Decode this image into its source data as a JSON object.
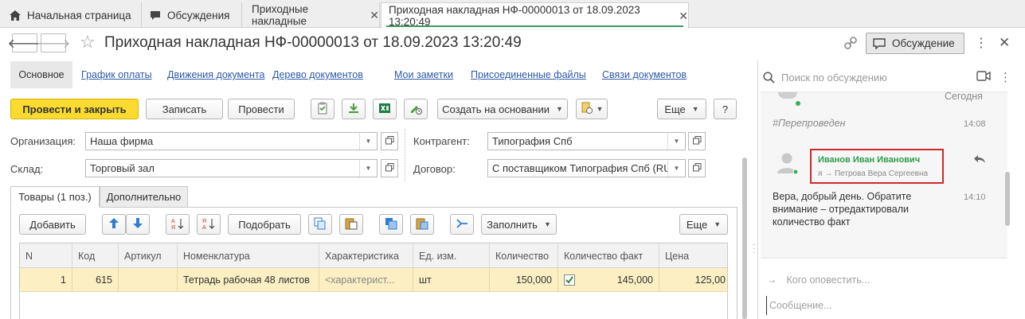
{
  "tabs": [
    {
      "label": "Начальная страница",
      "icon": "home-icon"
    },
    {
      "label": "Обсуждения",
      "icon": "chat-icon"
    },
    {
      "label": "Приходные накладные",
      "icon": "close-icon"
    },
    {
      "label": "Приходная накладная НФ-00000013 от 18.09.2023 13:20:49",
      "icon": "close-icon",
      "active": true
    }
  ],
  "header": {
    "title": "Приходная накладная НФ-00000013 от 18.09.2023 13:20:49",
    "discuss_label": "Обсуждение"
  },
  "subnav": {
    "active": "Основное",
    "links": [
      "График оплаты",
      "Движения документа",
      "Дерево документов",
      "Мои заметки",
      "Присоединенные файлы",
      "Связи документов"
    ]
  },
  "toolbar": {
    "post_close": "Провести и закрыть",
    "save": "Записать",
    "post": "Провести",
    "create_based": "Создать на основании",
    "more": "Еще",
    "help": "?"
  },
  "form": {
    "organization_label": "Организация:",
    "organization_value": "Наша фирма",
    "warehouse_label": "Склад:",
    "warehouse_value": "Торговый зал",
    "counterparty_label": "Контрагент:",
    "counterparty_value": "Типография Спб",
    "contract_label": "Договор:",
    "contract_value": "С поставщиком Типография Спб (RUB"
  },
  "inner_tabs": {
    "goods": "Товары (1 поз.)",
    "extra": "Дополнительно"
  },
  "goods_toolbar": {
    "add": "Добавить",
    "pick": "Подобрать",
    "fill": "Заполнить",
    "more": "Еще"
  },
  "table": {
    "columns": [
      "N",
      "Код",
      "Артикул",
      "Номенклатура",
      "Характеристика",
      "Ед. изм.",
      "Количество",
      "Количество факт",
      "Цена"
    ],
    "rows": [
      {
        "n": "1",
        "code": "615",
        "article": "",
        "item": "Тетрадь рабочая 48 листов",
        "characteristic": "<характерист...",
        "unit": "шт",
        "qty": "150,000",
        "qty_fact_checked": true,
        "qty_fact": "145,000",
        "price": "125,00"
      }
    ]
  },
  "discussion": {
    "search_placeholder": "Поиск по обсуждению",
    "day_label": "Сегодня",
    "hashtag": "#Перепроведен",
    "hashtag_time": "14:08",
    "sender": "Иванов Иван Иванович",
    "recipient": "я → Петрова Вера Сергеевна",
    "message": "Вера, добрый день. Обратите внимание – отредактировали количество факт",
    "message_time": "14:10",
    "notify_placeholder": "Кого оповестить...",
    "message_placeholder": "Сообщение..."
  },
  "colors": {
    "primary_button": "#fbdb2f",
    "selected_row": "#fbefc3",
    "link": "#2d5aa7",
    "sender": "#2e9b4c",
    "highlight_border": "#cc2b2b",
    "active_tab_underline": "#3c9a5f"
  }
}
